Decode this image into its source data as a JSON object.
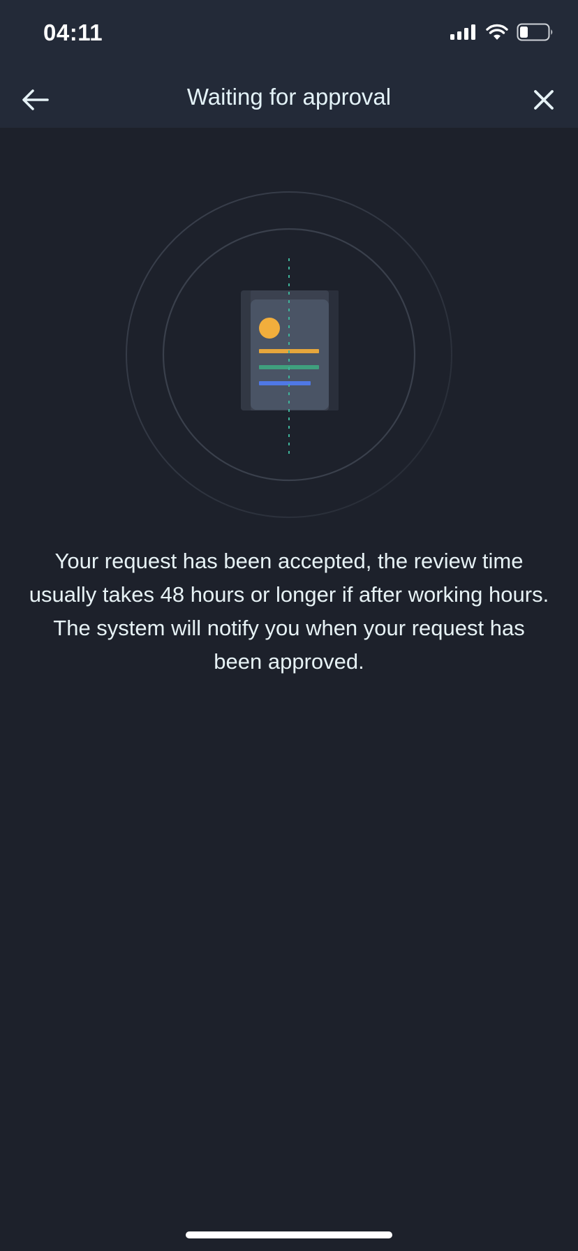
{
  "status_bar": {
    "time": "04:11",
    "icons": [
      "cellular-signal-icon",
      "wifi-icon",
      "battery-icon"
    ]
  },
  "nav": {
    "title": "Waiting for approval",
    "back_icon": "arrow-left-icon",
    "close_icon": "close-icon"
  },
  "illustration": {
    "icon": "document-scan-icon",
    "colors": {
      "avatar": "#f2ae3c",
      "line_orange": "#e6a63c",
      "line_green": "#3fa07e",
      "line_blue": "#4f78e6",
      "scan_line": "#3fb39a"
    }
  },
  "message": {
    "text": "Your request has been accepted, the review time usually takes 48 hours or longer if after working hours. The system will notify you when your request has been approved."
  },
  "colors": {
    "background": "#1d212b",
    "header": "#232a38",
    "text": "#e7f2f5"
  }
}
